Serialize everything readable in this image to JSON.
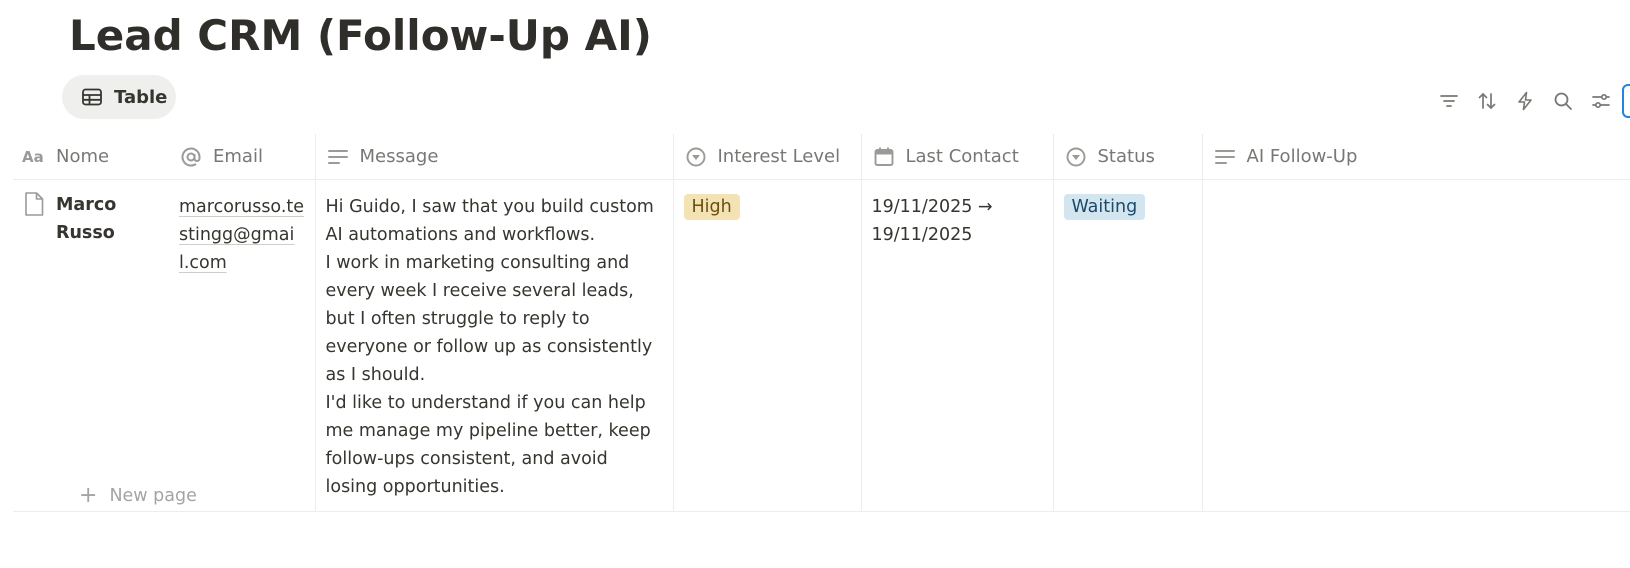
{
  "page": {
    "title": "Lead CRM (Follow-Up AI)"
  },
  "view": {
    "tab_label": "Table",
    "tab_icon": "table-icon"
  },
  "toolbar": {
    "icons": [
      "filter-icon",
      "sort-icon",
      "automation-bolt-icon",
      "search-icon",
      "settings-sliders-icon"
    ]
  },
  "columns": [
    {
      "label": "Nome",
      "icon": "text-aa-icon"
    },
    {
      "label": "Email",
      "icon": "at-sign-icon"
    },
    {
      "label": "Message",
      "icon": "text-lines-icon"
    },
    {
      "label": "Interest Level",
      "icon": "select-circle-icon"
    },
    {
      "label": "Last Contact",
      "icon": "calendar-icon"
    },
    {
      "label": "Status",
      "icon": "select-circle-icon"
    },
    {
      "label": "AI Follow-Up",
      "icon": "text-lines-icon"
    }
  ],
  "rows": [
    {
      "name": "Marco Russo",
      "email": "marcorusso.testingg@gmail.com",
      "message": "Hi Guido, I saw that you build custom AI automations and workflows. I work in marketing consulting and every week I receive several leads, but I often struggle to reply to everyone or follow up as consistently as I should. I'd like to understand if you can help me manage my pipeline better, keep follow-ups consistent, and avoid losing opportunities.",
      "message_lines": [
        "Hi Guido, I saw that you build custom AI automations and workflows.",
        "I work in marketing consulting and every week I receive several leads,",
        "but I often struggle to reply to everyone or follow up as consistently as I should.",
        "I'd like to understand if you can help me manage my pipeline better, keep follow-ups consistent, and avoid losing opportunities."
      ],
      "interest_level": "High",
      "last_contact": "19/11/2025 → 19/11/2025",
      "status": "Waiting",
      "ai_follow_up": ""
    }
  ],
  "footer": {
    "new_page_label": "New page"
  },
  "colors": {
    "high_tag_bg": "#f3e3b4",
    "waiting_tag_bg": "#d3e5ef",
    "accent": "#2383e2"
  }
}
